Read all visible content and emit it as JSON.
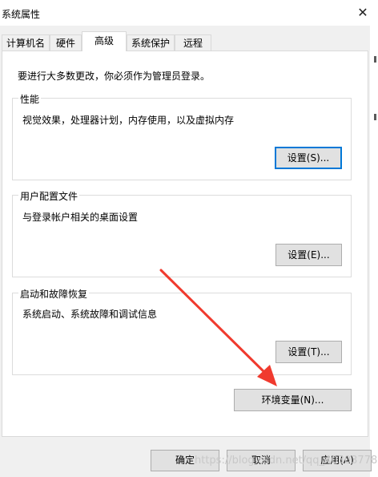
{
  "window": {
    "title": "系统属性",
    "close_glyph": "✕"
  },
  "tabs": [
    {
      "label": "计算机名",
      "active": false
    },
    {
      "label": "硬件",
      "active": false
    },
    {
      "label": "高级",
      "active": true
    },
    {
      "label": "系统保护",
      "active": false
    },
    {
      "label": "远程",
      "active": false
    }
  ],
  "notice": "要进行大多数更改，你必须作为管理员登录。",
  "groups": {
    "performance": {
      "title": "性能",
      "description": "视觉效果，处理器计划，内存使用，以及虚拟内存",
      "button": "设置(S)..."
    },
    "user_profiles": {
      "title": "用户配置文件",
      "description": "与登录帐户相关的桌面设置",
      "button": "设置(E)..."
    },
    "startup_recovery": {
      "title": "启动和故障恢复",
      "description": "系统启动、系统故障和调试信息",
      "button": "设置(T)..."
    }
  },
  "env_button": "环境变量(N)...",
  "footer": {
    "ok": "确定",
    "cancel": "取消",
    "apply": "应用(A)"
  },
  "watermark": "https://blog.csdn.net/qq_40303778",
  "colors": {
    "focus_border": "#0078d7",
    "arrow": "#f03a2e"
  }
}
